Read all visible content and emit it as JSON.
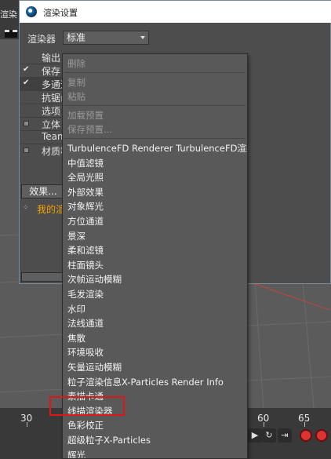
{
  "background": {
    "app_title": "渲染",
    "timeline": {
      "ticks": [
        "30",
        "60",
        "65"
      ]
    }
  },
  "dialog": {
    "title": "渲染设置",
    "renderer_label": "渲染器",
    "renderer_value": "标准",
    "nav_items": [
      {
        "label": "输出",
        "checked": false
      },
      {
        "label": "保存",
        "checked": true
      },
      {
        "label": "多通道",
        "checked": true
      },
      {
        "label": "抗锯齿",
        "checked": false
      },
      {
        "label": "选项",
        "checked": false
      },
      {
        "label": "立体",
        "checked": false
      },
      {
        "label": "Team",
        "checked": false
      },
      {
        "label": "材质覆写",
        "checked": false
      }
    ],
    "effects_button": "效果...",
    "my_render_setting": "我的渲染设置"
  },
  "context_menu": {
    "items": [
      {
        "label": "删除",
        "enabled": false
      },
      {
        "label": "复制",
        "enabled": false
      },
      {
        "label": "粘贴",
        "enabled": false
      },
      {
        "label": "加载预置",
        "enabled": false
      },
      {
        "label": "保存预置...",
        "enabled": false
      },
      {
        "label": "TurbulenceFD Renderer TurbulenceFD渲染器",
        "enabled": true
      },
      {
        "label": "中值滤镜",
        "enabled": true
      },
      {
        "label": "全局光照",
        "enabled": true
      },
      {
        "label": "外部效果",
        "enabled": true
      },
      {
        "label": "对象辉光",
        "enabled": true
      },
      {
        "label": "方位通道",
        "enabled": true
      },
      {
        "label": "景深",
        "enabled": true
      },
      {
        "label": "柔和滤镜",
        "enabled": true
      },
      {
        "label": "柱面镜头",
        "enabled": true
      },
      {
        "label": "次帧运动模糊",
        "enabled": true
      },
      {
        "label": "毛发渲染",
        "enabled": true
      },
      {
        "label": "水印",
        "enabled": true
      },
      {
        "label": "法线通道",
        "enabled": true
      },
      {
        "label": "焦散",
        "enabled": true
      },
      {
        "label": "环境吸收",
        "enabled": true
      },
      {
        "label": "矢量运动模糊",
        "enabled": true
      },
      {
        "label": "粒子渲染信息X-Particles Render Info",
        "enabled": true
      },
      {
        "label": "素描卡通",
        "enabled": true
      },
      {
        "label": "线描渲染器",
        "enabled": true,
        "highlighted": true
      },
      {
        "label": "色彩校正",
        "enabled": true
      },
      {
        "label": "超级粒子X-Particles",
        "enabled": true
      },
      {
        "label": "辉光",
        "enabled": true
      }
    ],
    "highlight_color": "#e01515"
  }
}
